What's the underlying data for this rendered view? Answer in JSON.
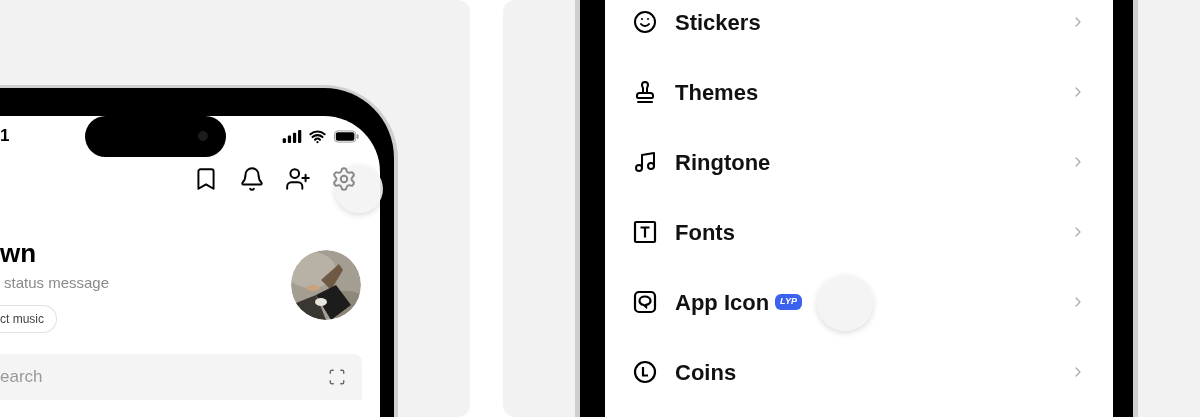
{
  "left_phone": {
    "status_bar": {
      "time": "1"
    },
    "profile": {
      "name": "wn",
      "status_message": "status message",
      "music_chip": "ct music"
    },
    "search": {
      "placeholder": "earch"
    }
  },
  "right_phone": {
    "menu": [
      {
        "label": "Stickers"
      },
      {
        "label": "Themes"
      },
      {
        "label": "Ringtone"
      },
      {
        "label": "Fonts"
      },
      {
        "label": "App Icon",
        "badge": "LYP"
      },
      {
        "label": "Coins"
      }
    ]
  }
}
